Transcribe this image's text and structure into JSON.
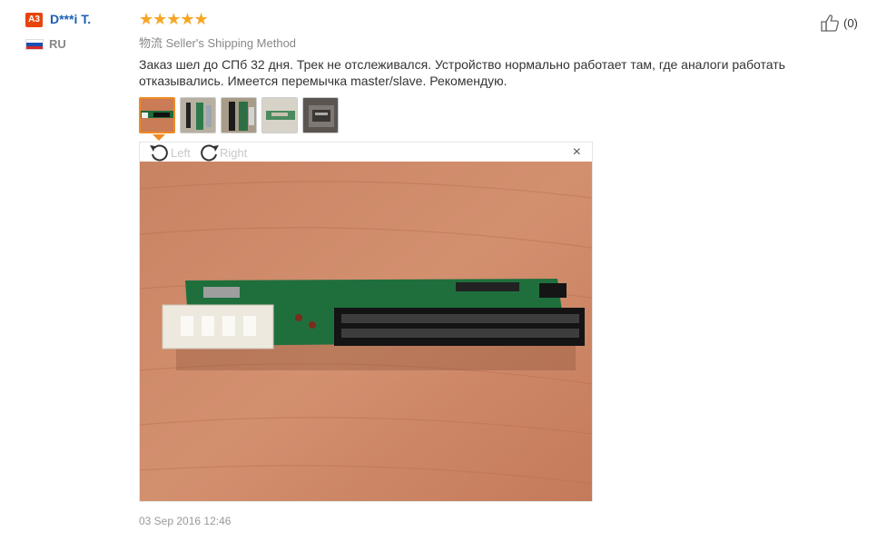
{
  "user": {
    "level_badge": "A3",
    "name": "D***i T.",
    "country": "RU",
    "flag_colors": [
      "#ffffff",
      "#1c4fb3",
      "#d62828"
    ]
  },
  "review": {
    "stars": "★★★★★",
    "rating": 5,
    "shipping_prefix": "物流",
    "shipping_method": "Seller's Shipping Method",
    "text": "Заказ шел до СПб 32 дня. Трек не отслеживался. Устройство нормально работает там, где аналоги работать отказывались. Имеется перемычка master/slave. Рекомендую.",
    "helpful_count": "(0)",
    "date": "03 Sep 2016 12:46"
  },
  "viewer": {
    "rotate_left_label": "Left",
    "rotate_right_label": "Right",
    "close_icon": "×",
    "rotate_left_icon": "rotate-left-icon",
    "rotate_right_icon": "rotate-right-icon"
  },
  "thumbnails": {
    "count": 5,
    "active_index": 0
  },
  "colors": {
    "accent": "#f08a24",
    "star": "#f5a623",
    "badge": "#e8440d",
    "name_link": "#1a5fb4"
  }
}
